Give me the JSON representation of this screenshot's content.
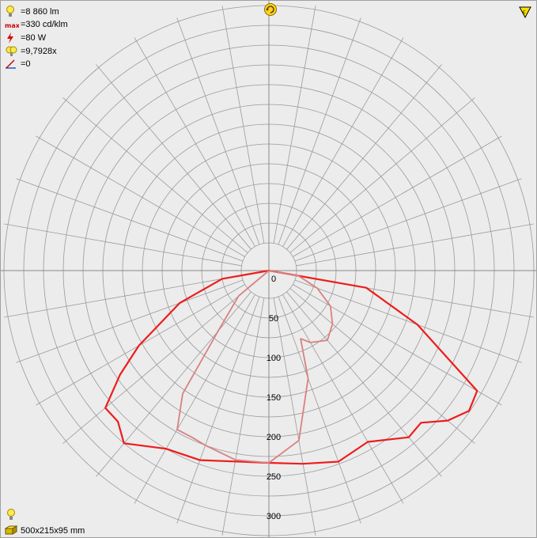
{
  "info": {
    "lumen": "=8 860 lm",
    "max_intensity": "=330 cd/klm",
    "power": "=80 W",
    "factor": "=9,7928x",
    "tilt": "=0"
  },
  "dimensions": "500x215x95 mm",
  "chart_data": {
    "type": "polar",
    "title": "",
    "radial_axis": {
      "min": 0,
      "max": 330,
      "ticks": [
        0,
        50,
        100,
        150,
        200,
        250,
        300
      ]
    },
    "angle_unit": "degrees from nadir (0 = straight down)",
    "angular_grid_step_deg": 10,
    "series": [
      {
        "color": "#ee1c1c",
        "points": [
          [
            -90,
            0
          ],
          [
            -80,
            60
          ],
          [
            -70,
            120
          ],
          [
            -60,
            190
          ],
          [
            -55,
            230
          ],
          [
            -50,
            270
          ],
          [
            -45,
            270
          ],
          [
            -40,
            285
          ],
          [
            -30,
            260
          ],
          [
            -20,
            255
          ],
          [
            -10,
            245
          ],
          [
            0,
            243
          ],
          [
            10,
            248
          ],
          [
            20,
            257
          ],
          [
            30,
            250
          ],
          [
            40,
            275
          ],
          [
            45,
            272
          ],
          [
            50,
            295
          ],
          [
            55,
            309
          ],
          [
            60,
            304
          ],
          [
            70,
            200
          ],
          [
            80,
            125
          ],
          [
            90,
            0
          ]
        ]
      },
      {
        "color": "#d98080",
        "points": [
          [
            -90,
            0
          ],
          [
            -50,
            50
          ],
          [
            -40,
            100
          ],
          [
            -35,
            190
          ],
          [
            -30,
            232
          ],
          [
            -25,
            232
          ],
          [
            -20,
            235
          ],
          [
            -10,
            243
          ],
          [
            0,
            243
          ],
          [
            10,
            218
          ],
          [
            20,
            145
          ],
          [
            25,
            95
          ],
          [
            30,
            105
          ],
          [
            40,
            115
          ],
          [
            50,
            105
          ],
          [
            60,
            90
          ],
          [
            70,
            65
          ],
          [
            80,
            38
          ],
          [
            90,
            0
          ]
        ]
      }
    ]
  }
}
